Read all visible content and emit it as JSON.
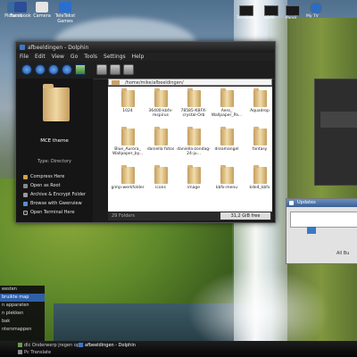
{
  "desktop": {
    "icons": [
      {
        "label": "Pictures",
        "icon": "pictures-icon"
      },
      {
        "label": "Facebook",
        "icon": "facebook-icon"
      },
      {
        "label": "Camera",
        "icon": "camera-icon"
      },
      {
        "label": "TeleTekst Games",
        "icon": "teletext-icon"
      }
    ],
    "tray": [
      {
        "label": "Terminal",
        "icon": "terminal-icon"
      },
      {
        "label": "SDPR",
        "icon": "sdpr-icon"
      },
      {
        "label": "Panel",
        "icon": "panel-icon"
      },
      {
        "label": "My TV",
        "icon": "globe-icon"
      }
    ]
  },
  "dolphin": {
    "title": "afbeeldingen - Dolphin",
    "menu": [
      "File",
      "Edit",
      "View",
      "Go",
      "Tools",
      "Settings",
      "Help"
    ],
    "location": "/home/mike/afbeeldingen/",
    "sidebar": {
      "title": "MCE theme",
      "type_label": "Type: Directory",
      "actions": [
        {
          "label": "Compress Here",
          "icon": "compress-icon"
        },
        {
          "label": "Open as Root",
          "icon": "root-icon"
        },
        {
          "label": "Archive & Encrypt Folder",
          "icon": "archive-icon"
        },
        {
          "label": "Browse with Gwenview",
          "icon": "gwenview-icon"
        },
        {
          "label": "Open Terminal Here",
          "icon": "terminal-icon"
        }
      ]
    },
    "files": [
      {
        "name": "1024"
      },
      {
        "name": "36400-kbfx-mspirus"
      },
      {
        "name": "78585-KBFX-crystal-Orb"
      },
      {
        "name": "Aero_ Wallpaper_Pa..."
      },
      {
        "name": "Aquadrop"
      },
      {
        "name": "Blue_Aurora_ Wallpaper_by..."
      },
      {
        "name": "daniella fotos"
      },
      {
        "name": "daniella-zondag-24-ju..."
      },
      {
        "name": "dreamangel"
      },
      {
        "name": "fantasy"
      },
      {
        "name": "gimp-werkfolder"
      },
      {
        "name": "icons"
      },
      {
        "name": "image"
      },
      {
        "name": "kbfx-menu"
      },
      {
        "name": "kde4_kbfx"
      }
    ],
    "status": "29 Folders",
    "free_space": "31,2 GiB free"
  },
  "dialog": {
    "title": "Updates",
    "label": "All Bu"
  },
  "start_menu": {
    "items": [
      {
        "label": "eesten",
        "selected": false
      },
      {
        "label": "bruikte map",
        "selected": true
      },
      {
        "label": "n apparaten",
        "selected": false
      },
      {
        "label": "n plekken",
        "selected": false
      },
      {
        "label": "bak",
        "selected": false
      },
      {
        "label": "ntersmappen",
        "selected": false
      }
    ]
  },
  "taskbar": {
    "tasks": [
      {
        "label": "dlc Onderwerp jregen op...",
        "active": false
      },
      {
        "label": "afbeeldingen - Dolphin",
        "active": true
      },
      {
        "label": "Pc Translate",
        "active": false
      }
    ]
  },
  "colors": {
    "selection": "#2e5fa8",
    "window_bg": "#1b1b1b",
    "folder": "#e8cc92"
  }
}
